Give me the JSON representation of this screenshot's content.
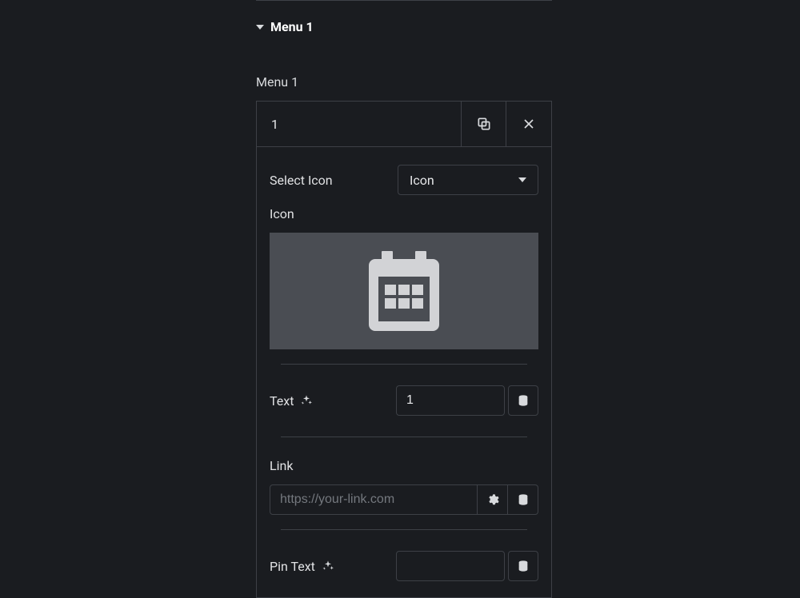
{
  "section": {
    "title": "Menu 1",
    "sub_label": "Menu 1"
  },
  "item": {
    "title": "1",
    "select_icon_label": "Select Icon",
    "icon_dropdown_value": "Icon",
    "icon_label": "Icon",
    "text_label": "Text",
    "text_value": "1",
    "link_label": "Link",
    "link_placeholder": "https://your-link.com",
    "link_value": "",
    "pin_text_label": "Pin Text",
    "pin_text_value": ""
  }
}
